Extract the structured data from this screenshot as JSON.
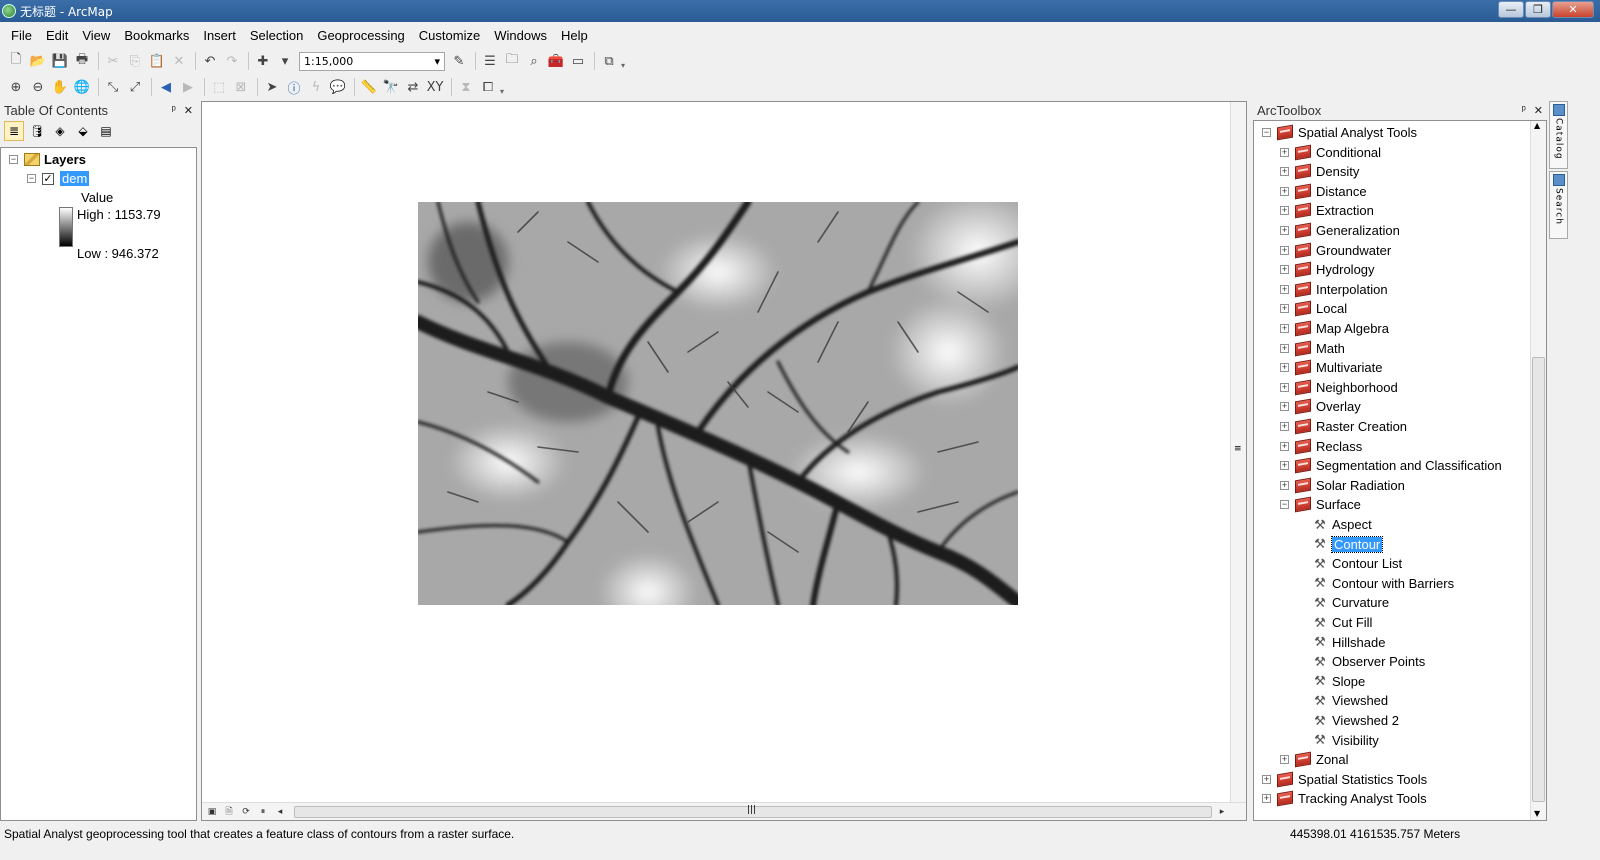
{
  "window": {
    "title": "无标题 - ArcMap",
    "controls": [
      "—",
      "❐",
      "✕"
    ]
  },
  "menu": [
    "File",
    "Edit",
    "View",
    "Bookmarks",
    "Insert",
    "Selection",
    "Geoprocessing",
    "Customize",
    "Windows",
    "Help"
  ],
  "toolbar": {
    "scale": "1:15,000",
    "dropdown_arrow": "▾"
  },
  "toc": {
    "title": "Table Of Contents",
    "pin": "ᵖ",
    "close": "✕",
    "root_expander": "−",
    "root_label": "Layers",
    "layer_expander": "−",
    "layer_checked": "✓",
    "layer_name": "dem",
    "legend_field": "Value",
    "legend_high": "High : 1153.79",
    "legend_low": "Low : 946.372"
  },
  "map": {
    "hscroll_grip": "|||",
    "vscroll_grip": "≡"
  },
  "arctoolbox": {
    "title": "ArcToolbox",
    "pin": "ᵖ",
    "close": "✕",
    "root": {
      "expander": "−",
      "label": "Spatial Analyst Tools"
    },
    "toolsets": [
      {
        "expander": "+",
        "label": "Conditional"
      },
      {
        "expander": "+",
        "label": "Density"
      },
      {
        "expander": "+",
        "label": "Distance"
      },
      {
        "expander": "+",
        "label": "Extraction"
      },
      {
        "expander": "+",
        "label": "Generalization"
      },
      {
        "expander": "+",
        "label": "Groundwater"
      },
      {
        "expander": "+",
        "label": "Hydrology"
      },
      {
        "expander": "+",
        "label": "Interpolation"
      },
      {
        "expander": "+",
        "label": "Local"
      },
      {
        "expander": "+",
        "label": "Map Algebra"
      },
      {
        "expander": "+",
        "label": "Math"
      },
      {
        "expander": "+",
        "label": "Multivariate"
      },
      {
        "expander": "+",
        "label": "Neighborhood"
      },
      {
        "expander": "+",
        "label": "Overlay"
      },
      {
        "expander": "+",
        "label": "Raster Creation"
      },
      {
        "expander": "+",
        "label": "Reclass"
      },
      {
        "expander": "+",
        "label": "Segmentation and Classification"
      },
      {
        "expander": "+",
        "label": "Solar Radiation"
      },
      {
        "expander": "−",
        "label": "Surface"
      }
    ],
    "surface_tools": [
      "Aspect",
      "Contour",
      "Contour List",
      "Contour with Barriers",
      "Curvature",
      "Cut Fill",
      "Hillshade",
      "Observer Points",
      "Slope",
      "Viewshed",
      "Viewshed 2",
      "Visibility"
    ],
    "selected_tool": "Contour",
    "after_toolsets": [
      {
        "expander": "+",
        "label": "Zonal"
      }
    ],
    "other_toolboxes": [
      {
        "expander": "+",
        "label": "Spatial Statistics Tools"
      },
      {
        "expander": "+",
        "label": "Tracking Analyst Tools"
      }
    ],
    "scroll_up": "▲",
    "scroll_down": "▼"
  },
  "side_tabs": [
    "Catalog",
    "Search"
  ],
  "status": {
    "message": "Spatial Analyst geoprocessing tool that creates a feature class of contours from a raster surface.",
    "coordinates": "445398.01  4161535.757 Meters"
  }
}
